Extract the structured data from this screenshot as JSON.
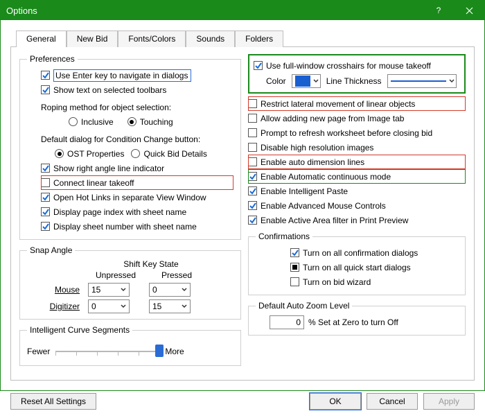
{
  "window": {
    "title": "Options"
  },
  "tabs": [
    "General",
    "New Bid",
    "Fonts/Colors",
    "Sounds",
    "Folders"
  ],
  "active_tab": 0,
  "left": {
    "preferences_legend": "Preferences",
    "use_enter": "Use Enter key to navigate in dialogs",
    "show_text": "Show text on selected toolbars",
    "roping_label": "Roping method for object selection:",
    "roping_inclusive": "Inclusive",
    "roping_touching": "Touching",
    "default_dialog_label": "Default dialog for Condition Change button:",
    "ost_properties": "OST Properties",
    "quick_bid_details": "Quick Bid Details",
    "show_right_angle": "Show right angle line indicator",
    "connect_linear": "Connect linear takeoff",
    "open_hot_links": "Open Hot Links in separate View Window",
    "display_page_index": "Display page index with sheet name",
    "display_sheet_number": "Display sheet number with sheet name",
    "snap_legend": "Snap Angle",
    "shift_key_state": "Shift Key State",
    "unpressed": "Unpressed",
    "pressed": "Pressed",
    "mouse_label": "Mouse",
    "digitizer_label": "Digitizer",
    "mouse_unpressed": "15",
    "mouse_pressed": "0",
    "dig_unpressed": "0",
    "dig_pressed": "15",
    "curve_legend": "Intelligent Curve Segments",
    "fewer": "Fewer",
    "more": "More"
  },
  "right": {
    "use_full_window": "Use full-window crosshairs for mouse takeoff",
    "color_label": "Color",
    "line_thickness_label": "Line Thickness",
    "restrict_lateral": "Restrict lateral movement of linear objects",
    "allow_new_page": "Allow adding new page from Image tab",
    "prompt_refresh": "Prompt to refresh worksheet before closing bid",
    "disable_high_res": "Disable high resolution images",
    "enable_auto_dim": "Enable auto dimension lines",
    "enable_auto_cont": "Enable Automatic continuous mode",
    "enable_ipaste": "Enable Intelligent Paste",
    "enable_adv_mouse": "Enable Advanced Mouse Controls",
    "enable_active_area": "Enable Active Area filter in Print Preview",
    "confirm_legend": "Confirmations",
    "confirm_all": "Turn on all confirmation dialogs",
    "confirm_quick": "Turn on all quick start dialogs",
    "confirm_bid": "Turn on bid wizard",
    "zoom_legend": "Default Auto Zoom Level",
    "zoom_value": "0",
    "zoom_suffix": "%    Set at Zero to turn Off"
  },
  "footer": {
    "reset": "Reset All Settings",
    "ok": "OK",
    "cancel": "Cancel",
    "apply": "Apply"
  },
  "colors": {
    "accent": "#1a8a1a",
    "blue": "#2a6cd4",
    "red": "#d23a2a"
  }
}
